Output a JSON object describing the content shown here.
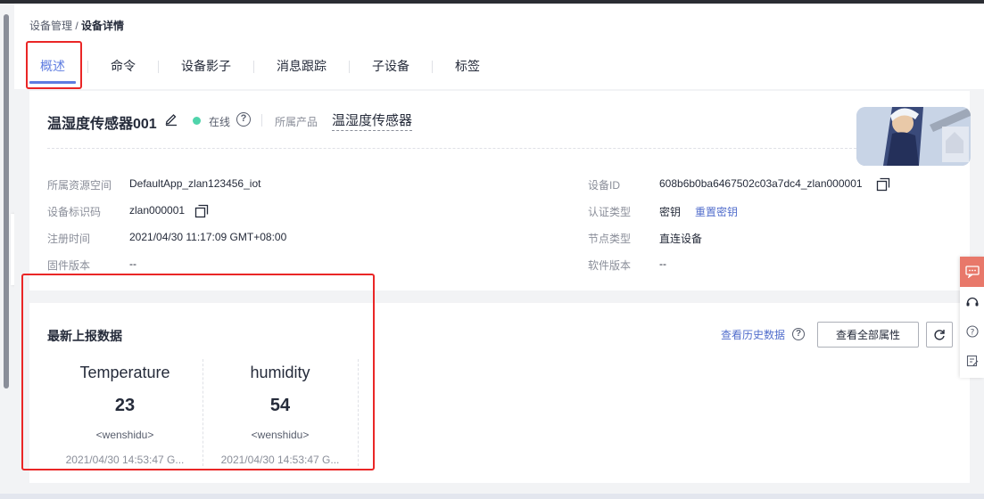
{
  "breadcrumb": {
    "parent": "设备管理",
    "separator": "/",
    "current": "设备详情"
  },
  "tabs": [
    {
      "label": "概述",
      "active": true
    },
    {
      "label": "命令"
    },
    {
      "label": "设备影子"
    },
    {
      "label": "消息跟踪"
    },
    {
      "label": "子设备"
    },
    {
      "label": "标签"
    }
  ],
  "device": {
    "name": "温湿度传感器001",
    "status": "在线",
    "status_color": "#50d4ab",
    "product_label": "所属产品",
    "product_name": "温湿度传感器"
  },
  "info": {
    "space_label": "所属资源空间",
    "space_value": "DefaultApp_zlan123456_iot",
    "devid_label": "设备ID",
    "devid_value": "608b6b0ba6467502c03a7dc4_zlan000001",
    "code_label": "设备标识码",
    "code_value": "zlan000001",
    "auth_label": "认证类型",
    "auth_value": "密钥",
    "auth_link": "重置密钥",
    "reg_label": "注册时间",
    "reg_value": "2021/04/30 11:17:09 GMT+08:00",
    "node_label": "节点类型",
    "node_value": "直连设备",
    "fw_label": "固件版本",
    "fw_value": "--",
    "sw_label": "软件版本",
    "sw_value": "--"
  },
  "latest": {
    "title": "最新上报数据",
    "history_link": "查看历史数据",
    "all_props_button": "查看全部属性",
    "metrics": [
      {
        "name": "Temperature",
        "value": "23",
        "unit": "<wenshidu>",
        "time": "2021/04/30 14:53:47 G..."
      },
      {
        "name": "humidity",
        "value": "54",
        "unit": "<wenshidu>",
        "time": "2021/04/30 14:53:47 G..."
      }
    ]
  },
  "colors": {
    "accent": "#5e7ce0",
    "link": "#526ecc",
    "highlight": "#ea2626",
    "dock_accent": "#e8786a"
  }
}
